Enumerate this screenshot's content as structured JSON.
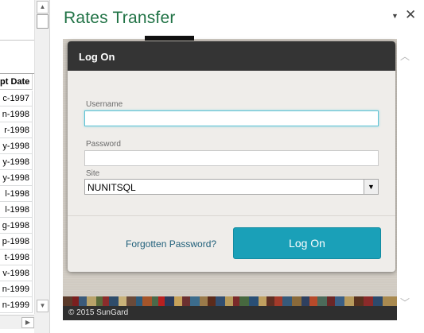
{
  "spreadsheet": {
    "column_header": "pt Date",
    "rows": [
      "c-1997",
      "n-1998",
      "r-1998",
      "y-1998",
      "y-1998",
      "y-1998",
      "l-1998",
      "l-1998",
      "g-1998",
      "p-1998",
      "t-1998",
      "v-1998",
      "n-1999",
      "n-1999"
    ]
  },
  "task_pane": {
    "title": "Rates Transfer",
    "menu_glyph": "▼",
    "close_glyph": "✕"
  },
  "dialog": {
    "title": "Log On",
    "username_label": "Username",
    "username_value": "",
    "password_label": "Password",
    "password_value": "",
    "site_label": "Site",
    "site_value": "NUNITSQL",
    "forgot_link": "Forgotten Password?",
    "logon_button": "Log On"
  },
  "footer": {
    "copyright": "© 2015 SunGard"
  },
  "colors": {
    "pane_title": "#217346",
    "dialog_titlebar": "#343434",
    "logon_button": "#1aa0b8",
    "link": "#1f5f7a",
    "focus_border": "#5fc3d4"
  }
}
